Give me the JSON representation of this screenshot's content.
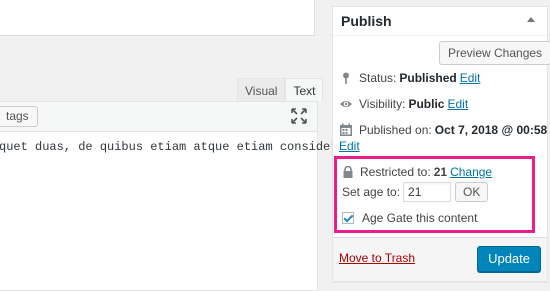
{
  "editor": {
    "tabs": [
      {
        "label": "Visual"
      },
      {
        "label": "Text"
      }
    ],
    "toolbar_button": "tags",
    "content_text": "quet duas, de quibus etiam atque etiam consideret."
  },
  "publish": {
    "title": "Publish",
    "preview_button": "Preview Changes",
    "status_label": "Status:",
    "status_value": "Published",
    "visibility_label": "Visibility:",
    "visibility_value": "Public",
    "published_label": "Published on:",
    "published_value": "Oct 7, 2018 @ 00:58",
    "edit_link": "Edit",
    "age_gate": {
      "restricted_label": "Restricted to:",
      "restricted_value": "21",
      "change_link": "Change",
      "set_age_label": "Set age to:",
      "age_input_value": "21",
      "ok_button": "OK",
      "checkbox_label": "Age Gate this content",
      "checkbox_checked": true,
      "highlight_color": "#ec1c8b"
    },
    "trash_link": "Move to Trash",
    "update_button": "Update",
    "accent_color": "#0085ba"
  }
}
